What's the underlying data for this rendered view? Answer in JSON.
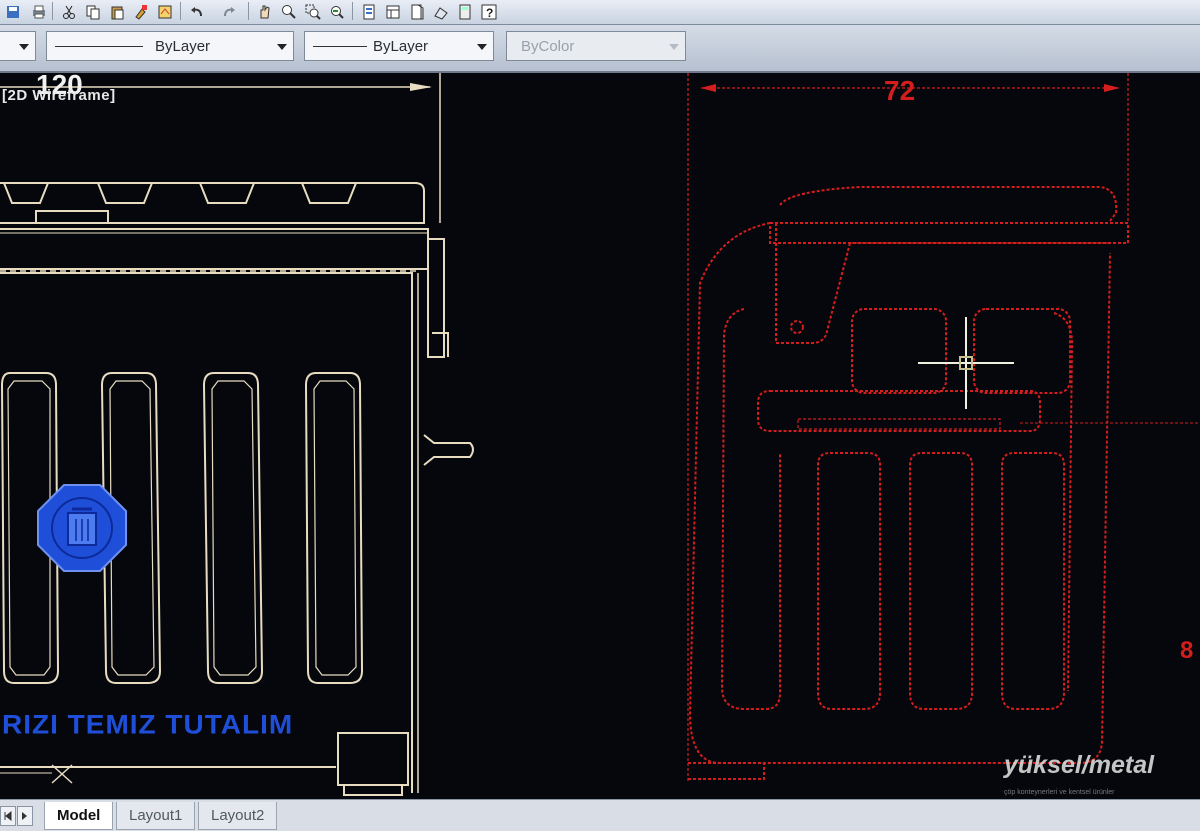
{
  "toolbar": {
    "icons": [
      "save-as-icon",
      "plot-icon",
      "copy-icon",
      "paste-icon",
      "cut-icon",
      "match-properties-icon",
      "undo-icon",
      "redo-icon",
      "pan-icon",
      "zoom-realtime-icon",
      "zoom-window-icon",
      "zoom-previous-icon",
      "properties-icon",
      "design-center-icon",
      "tool-palettes-icon",
      "sheet-set-icon",
      "markup-icon",
      "calculator-icon",
      "help-icon"
    ]
  },
  "properties": {
    "color_value": "",
    "linetype_value": "ByLayer",
    "lineweight_value": "ByLayer",
    "plotstyle_value": "ByColor"
  },
  "viewport": {
    "label": "[2D Wireframe]"
  },
  "drawing": {
    "dim_front": "120",
    "dim_side": "72",
    "dim_partial": "8",
    "slogan": "RIZI TEMIZ TUTALIM",
    "colors": {
      "front_lines": "#e8dcc0",
      "side_lines": "#d41e1e",
      "logo": "#1f4fd9",
      "crosshair": "#f0f0e0",
      "background": "#05070c"
    }
  },
  "watermark": {
    "brand": "yüksel/metal",
    "tagline": "çöp konteynerleri ve kentsel ürünler"
  },
  "tabs": {
    "model": "Model",
    "layout1": "Layout1",
    "layout2": "Layout2"
  }
}
